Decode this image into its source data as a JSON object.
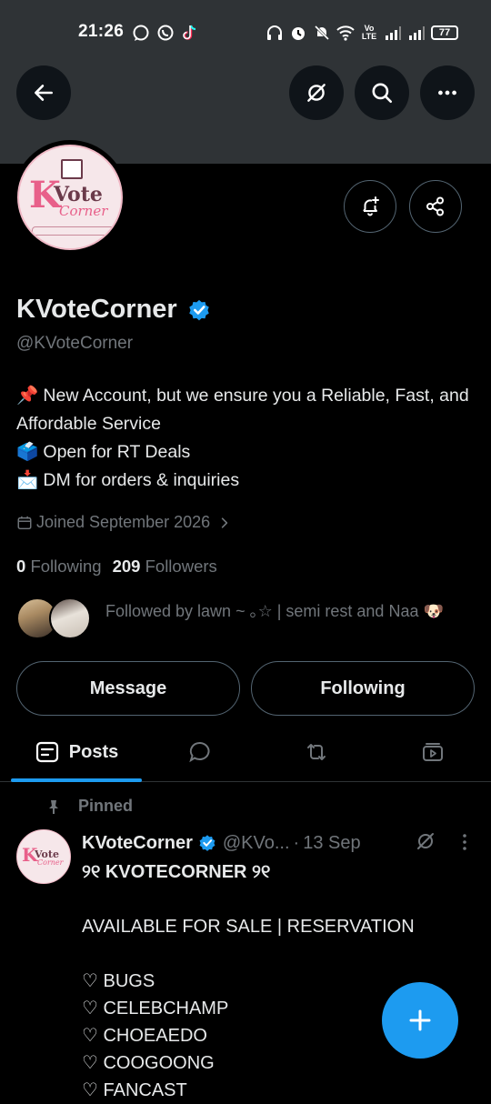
{
  "status_bar": {
    "time": "21:26",
    "network_label": "Vo LTE",
    "battery": "77"
  },
  "profile": {
    "display_name": "KVoteCorner",
    "handle": "@KVoteCorner",
    "bio": {
      "line1_emoji": "📌",
      "line1": "New Account, but we ensure you a Reliable, Fast, and Affordable Service",
      "line2_emoji": "🗳️",
      "line2": "Open for RT Deals",
      "line3_emoji": "📩",
      "line3": "DM for orders & inquiries"
    },
    "joined": "Joined September 2026",
    "following_count": "0",
    "following_label": "Following",
    "followers_count": "209",
    "followers_label": "Followers",
    "followed_by": "Followed by lawn ~ ｡☆ | semi rest and Naa 🐶",
    "avatar_logo": {
      "k": "K",
      "vote": "Vote",
      "corner": "Corner"
    }
  },
  "buttons": {
    "message": "Message",
    "following": "Following"
  },
  "tabs": {
    "posts": "Posts"
  },
  "pinned_post": {
    "pinned_label": "Pinned",
    "author": "KVoteCorner",
    "handle": "@KVo...",
    "dot": "·",
    "date": "13 Sep",
    "title": "୨୧ KVOTECORNER ୨୧",
    "line_available": "AVAILABLE FOR SALE | RESERVATION",
    "items": [
      "♡ BUGS",
      "♡ CELEBCHAMP",
      "♡ CHOEAEDO",
      "♡ COOGOONG",
      "♡ FANCAST"
    ]
  },
  "colors": {
    "accent": "#1d9bf0",
    "header_bg": "#2f3336",
    "muted": "#71767b",
    "logo_pink": "#e8608a"
  }
}
